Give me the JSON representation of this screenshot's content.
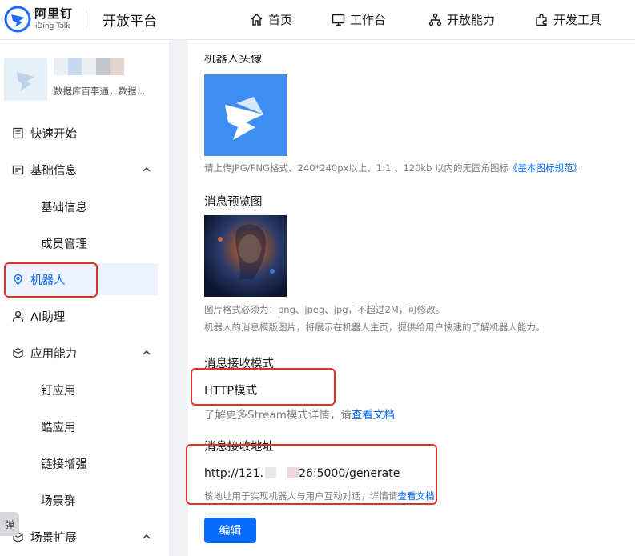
{
  "header": {
    "brand_cn": "阿里钉",
    "brand_en": "iDing Talk",
    "platform_title": "开放平台",
    "nav": [
      {
        "label": "首页",
        "icon": "home-icon"
      },
      {
        "label": "工作台",
        "icon": "monitor-icon"
      },
      {
        "label": "开放能力",
        "icon": "tree-icon"
      },
      {
        "label": "开发工具",
        "icon": "puzzle-icon"
      }
    ]
  },
  "sidebar": {
    "app_desc": "数据库百事通，数据...",
    "items": [
      {
        "label": "快速开始",
        "icon": "document-icon"
      },
      {
        "label": "基础信息",
        "icon": "card-icon"
      },
      {
        "label": "基础信息"
      },
      {
        "label": "成员管理"
      },
      {
        "label": "机器人",
        "icon": "robot-icon"
      },
      {
        "label": "AI助理",
        "icon": "user-icon"
      },
      {
        "label": "应用能力",
        "icon": "cube-icon"
      },
      {
        "label": "钉应用"
      },
      {
        "label": "酷应用"
      },
      {
        "label": "链接增强"
      },
      {
        "label": "场景群"
      },
      {
        "label": "场景扩展",
        "icon": "cube-icon"
      }
    ],
    "float_button": "弹"
  },
  "main": {
    "avatar_section_title": "机器人头像",
    "avatar_hint": "请上传JPG/PNG格式、240*240px以上、1:1 、120kb 以内的无圆角图标",
    "avatar_hint_link": "《基本图标规范》",
    "preview_title": "消息预览图",
    "preview_hint_1": "图片格式必须为：png、jpeg、jpg，不超过2M，可修改。",
    "preview_hint_2": "机器人的消息模版图片，将展示在机器人主页，提供给用户快速的了解机器人能力。",
    "receive_mode_title": "消息接收模式",
    "receive_mode_value": "HTTP模式",
    "receive_mode_hint": "了解更多Stream模式详情，请",
    "receive_mode_link": "查看文档",
    "receive_url_title": "消息接收地址",
    "receive_url_prefix": "http://121.",
    "receive_url_suffix": "26:5000/generate",
    "receive_url_hint": "该地址用于实现机器人与用户互动对话，详情请",
    "receive_url_link": "查看文档",
    "edit_button": "编辑"
  },
  "colors": {
    "accent": "#0066ff",
    "highlight": "#e0322a"
  }
}
